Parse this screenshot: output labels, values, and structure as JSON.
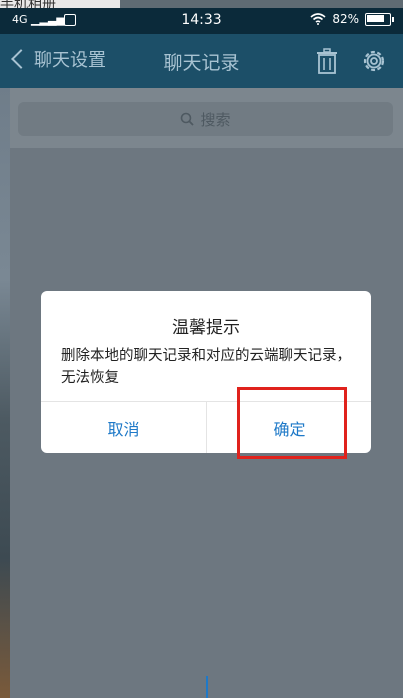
{
  "top_overlay": {
    "text": "手机相册"
  },
  "status_bar": {
    "network": "4G",
    "time": "14:33",
    "battery": "82%"
  },
  "nav": {
    "back_label": "聊天设置",
    "title": "聊天记录",
    "icons": [
      "trash-icon",
      "gear-icon"
    ]
  },
  "search": {
    "placeholder": "搜索"
  },
  "dialog": {
    "title": "温馨提示",
    "message": "删除本地的聊天记录和对应的云端聊天记录，无法恢复",
    "cancel_label": "取消",
    "confirm_label": "确定"
  },
  "colors": {
    "navbar": "#1c4f68",
    "button_text": "#1e79c8",
    "highlight": "#e0221c"
  }
}
